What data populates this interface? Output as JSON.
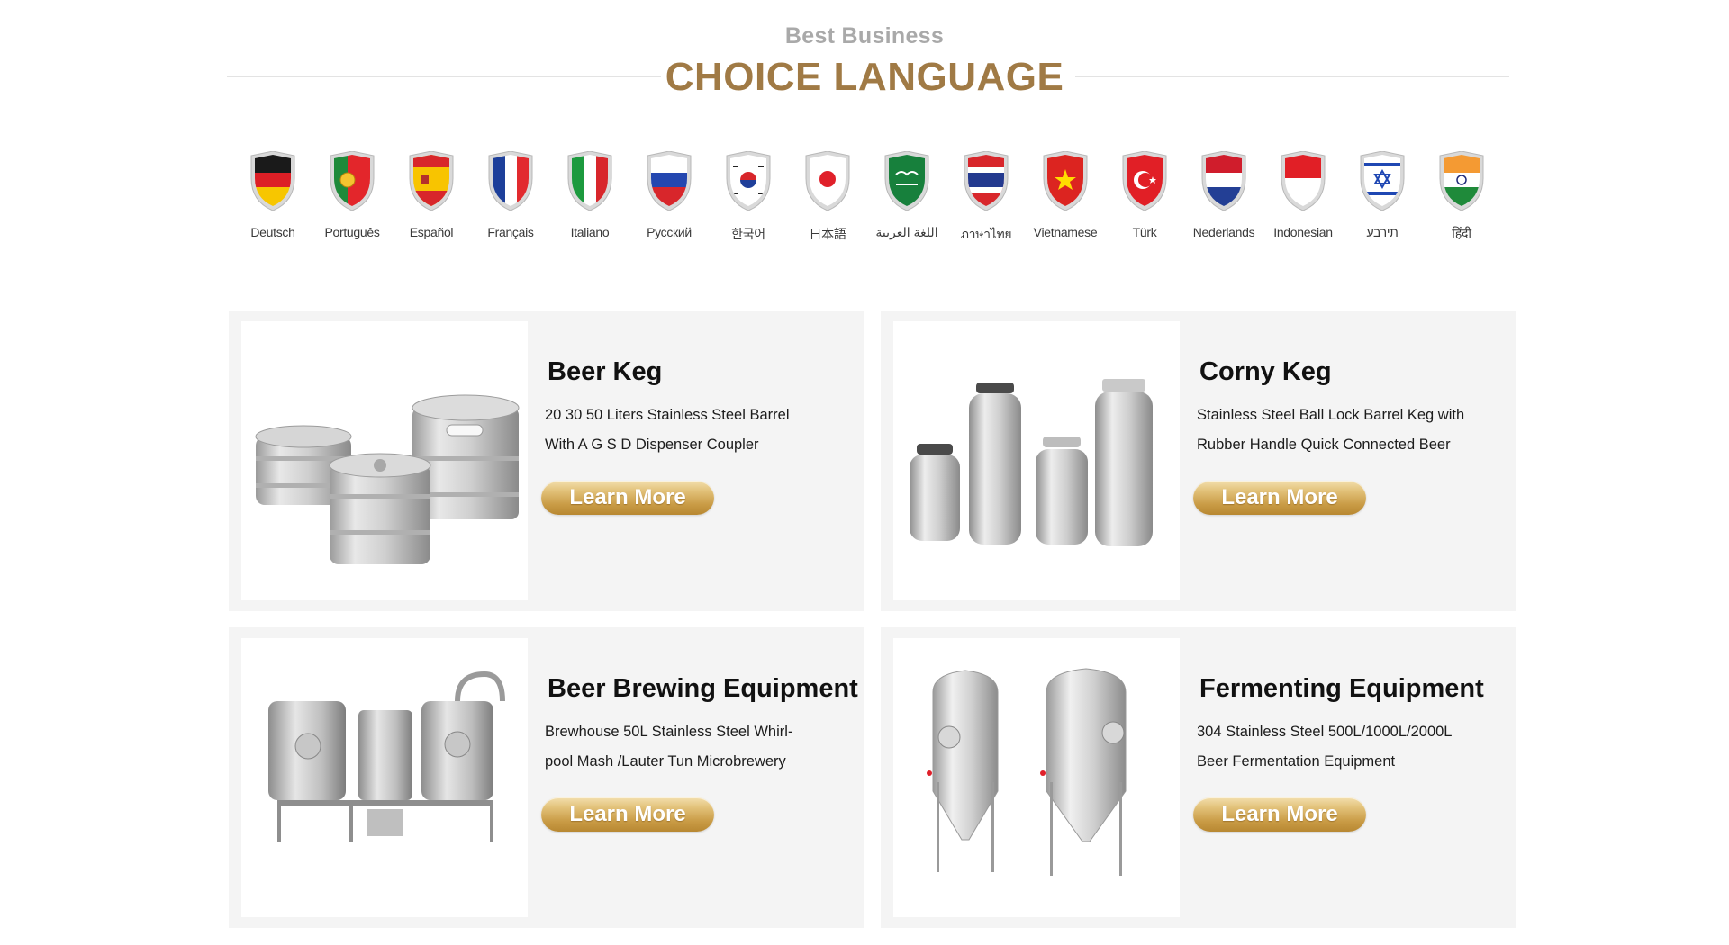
{
  "heading": {
    "subtitle": "Best Business",
    "title": "CHOICE LANGUAGE"
  },
  "languages": [
    {
      "label": "Deutsch",
      "icon": "germany-flag-icon"
    },
    {
      "label": "Português",
      "icon": "portugal-flag-icon"
    },
    {
      "label": "Español",
      "icon": "spain-flag-icon"
    },
    {
      "label": "Français",
      "icon": "france-flag-icon"
    },
    {
      "label": "Italiano",
      "icon": "italy-flag-icon"
    },
    {
      "label": "Русский",
      "icon": "russia-flag-icon"
    },
    {
      "label": "한국어",
      "icon": "korea-flag-icon"
    },
    {
      "label": "日本語",
      "icon": "japan-flag-icon"
    },
    {
      "label": "اللغة العربية",
      "icon": "saudi-arabia-flag-icon"
    },
    {
      "label": "ภาษาไทย",
      "icon": "thailand-flag-icon"
    },
    {
      "label": "Vietnamese",
      "icon": "vietnam-flag-icon"
    },
    {
      "label": "Türk",
      "icon": "turkey-flag-icon"
    },
    {
      "label": "Nederlands",
      "icon": "netherlands-flag-icon"
    },
    {
      "label": "Indonesian",
      "icon": "indonesia-flag-icon"
    },
    {
      "label": "תירבע",
      "icon": "israel-flag-icon"
    },
    {
      "label": "हिंदी",
      "icon": "india-flag-icon"
    }
  ],
  "products": [
    {
      "title": "Beer Keg",
      "desc_line1": "20 30 50 Liters Stainless Steel Barrel",
      "desc_line2": "With A G S D Dispenser Coupler",
      "button": "Learn More",
      "image_icon": "beer-keg-image"
    },
    {
      "title": "Corny Keg",
      "desc_line1": "Stainless Steel Ball Lock Barrel Keg with",
      "desc_line2": "Rubber Handle Quick Connected Beer",
      "button": "Learn More",
      "image_icon": "corny-keg-image"
    },
    {
      "title": "Beer Brewing Equipment",
      "desc_line1": "Brewhouse 50L Stainless Steel Whirl-",
      "desc_line2": "pool Mash /Lauter Tun Microbrewery",
      "button": "Learn More",
      "image_icon": "brewing-equipment-image"
    },
    {
      "title": "Fermenting Equipment",
      "desc_line1": "304 Stainless Steel 500L/1000L/2000L",
      "desc_line2": "Beer Fermentation Equipment",
      "button": "Learn More",
      "image_icon": "fermenting-tank-image"
    }
  ],
  "colors": {
    "title_gold": "#a07a45",
    "subtitle_gray": "#a9a9a9",
    "card_bg": "#f4f4f4",
    "button_gold": "#c99b45"
  }
}
